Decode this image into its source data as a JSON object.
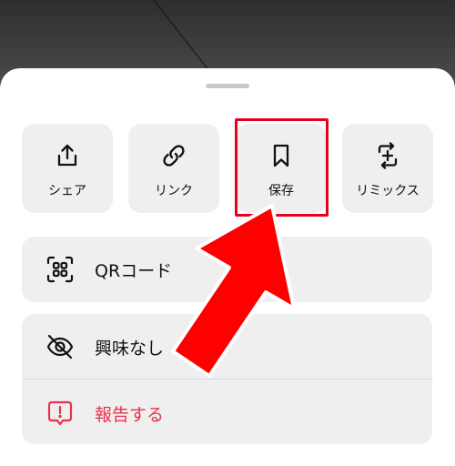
{
  "share_sheet": {
    "actions": [
      {
        "label": "シェア",
        "icon": "share-icon"
      },
      {
        "label": "リンク",
        "icon": "link-icon"
      },
      {
        "label": "保存",
        "icon": "bookmark-icon"
      },
      {
        "label": "リミックス",
        "icon": "remix-icon"
      }
    ],
    "qr": {
      "label": "QRコード",
      "icon": "qr-code-icon"
    },
    "not_interested": {
      "label": "興味なし",
      "icon": "eye-slash-icon"
    },
    "report": {
      "label": "報告する",
      "icon": "report-icon"
    }
  },
  "colors": {
    "sheet_background": "#ffffff",
    "tile_background": "#efefef",
    "highlight_red": "#e5001c",
    "danger_text": "#e5334b"
  }
}
